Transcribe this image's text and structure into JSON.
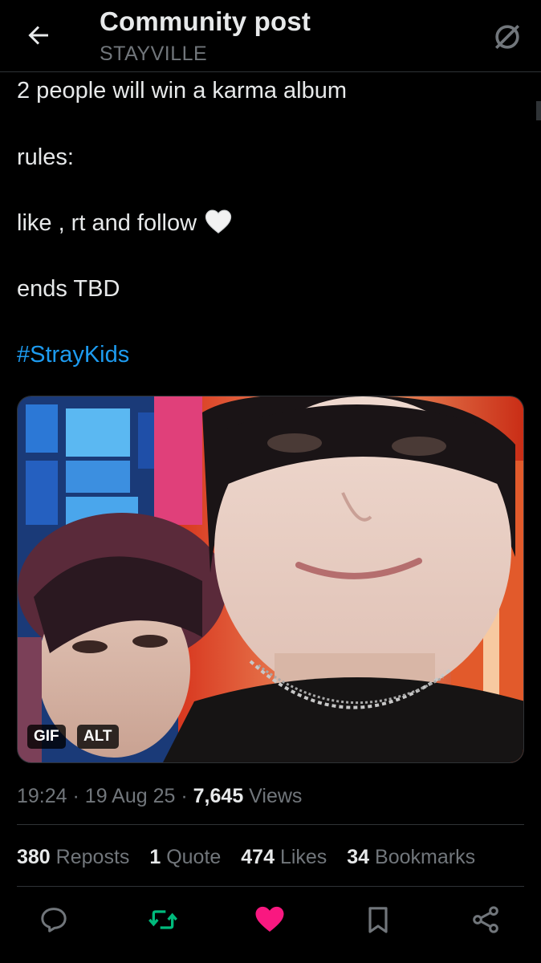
{
  "header": {
    "title": "Community post",
    "subtitle": "STAYVILLE"
  },
  "post": {
    "lines": [
      "2 people will win a karma album",
      "rules:",
      "like , rt and follow",
      "ends TBD"
    ],
    "hashtag": "#StrayKids",
    "media": {
      "badge_gif": "GIF",
      "badge_alt": "ALT"
    }
  },
  "meta": {
    "time": "19:24",
    "date": "19 Aug 25",
    "sep": "·",
    "views_count": "7,645",
    "views_label": "Views"
  },
  "stats": {
    "reposts_count": "380",
    "reposts_label": "Reposts",
    "quotes_count": "1",
    "quotes_label": "Quote",
    "likes_count": "474",
    "likes_label": "Likes",
    "bookmarks_count": "34",
    "bookmarks_label": "Bookmarks"
  },
  "colors": {
    "background": "#000000",
    "text": "#e7e9ea",
    "muted": "#71767b",
    "link": "#1d9bf0",
    "repost": "#00ba7c",
    "like": "#f91880"
  },
  "icons": [
    "back-arrow-icon",
    "no-symbol-icon",
    "white-heart-emoji",
    "reply-icon",
    "repost-icon",
    "like-icon",
    "bookmark-icon",
    "share-icon"
  ]
}
